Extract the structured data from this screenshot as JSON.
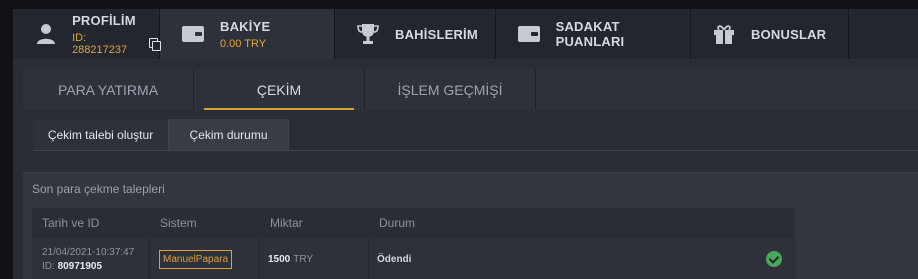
{
  "header": {
    "profile": {
      "label": "PROFİLİM",
      "id_text": "ID: 288217237",
      "icon": "user-icon"
    },
    "balance": {
      "label": "BAKİYE",
      "value": "0.00 TRY",
      "icon": "wallet-icon"
    },
    "bets": {
      "label": "BAHİSLERİM",
      "icon": "trophy-icon"
    },
    "loyalty": {
      "label": "SADAKAT PUANLARI",
      "icon": "wallet-icon"
    },
    "bonuses": {
      "label": "BONUSLAR",
      "icon": "gift-icon"
    }
  },
  "tabs": [
    {
      "label": "PARA YATIRMA"
    },
    {
      "label": "ÇEKİM",
      "active": true
    },
    {
      "label": "İŞLEM GEÇMİŞİ"
    }
  ],
  "actions": {
    "create": "Çekim talebi oluştur",
    "status": "Çekim durumu"
  },
  "requests": {
    "title": "Son para çekme talepleri",
    "columns": [
      "Tarih ve ID",
      "Sistem",
      "Miktar",
      "Durum"
    ],
    "rows": [
      {
        "date": "21/04/2021-10:37:47",
        "id_prefix": "ID:",
        "id": "80971905",
        "system": "ManuelPapara",
        "amount": "1500",
        "currency": "TRY",
        "status": "Ödendi",
        "status_icon": "check-circle-icon"
      }
    ]
  },
  "colors": {
    "accent": "#d8a13a",
    "success": "#47a85a",
    "panel": "#2a2d35"
  }
}
